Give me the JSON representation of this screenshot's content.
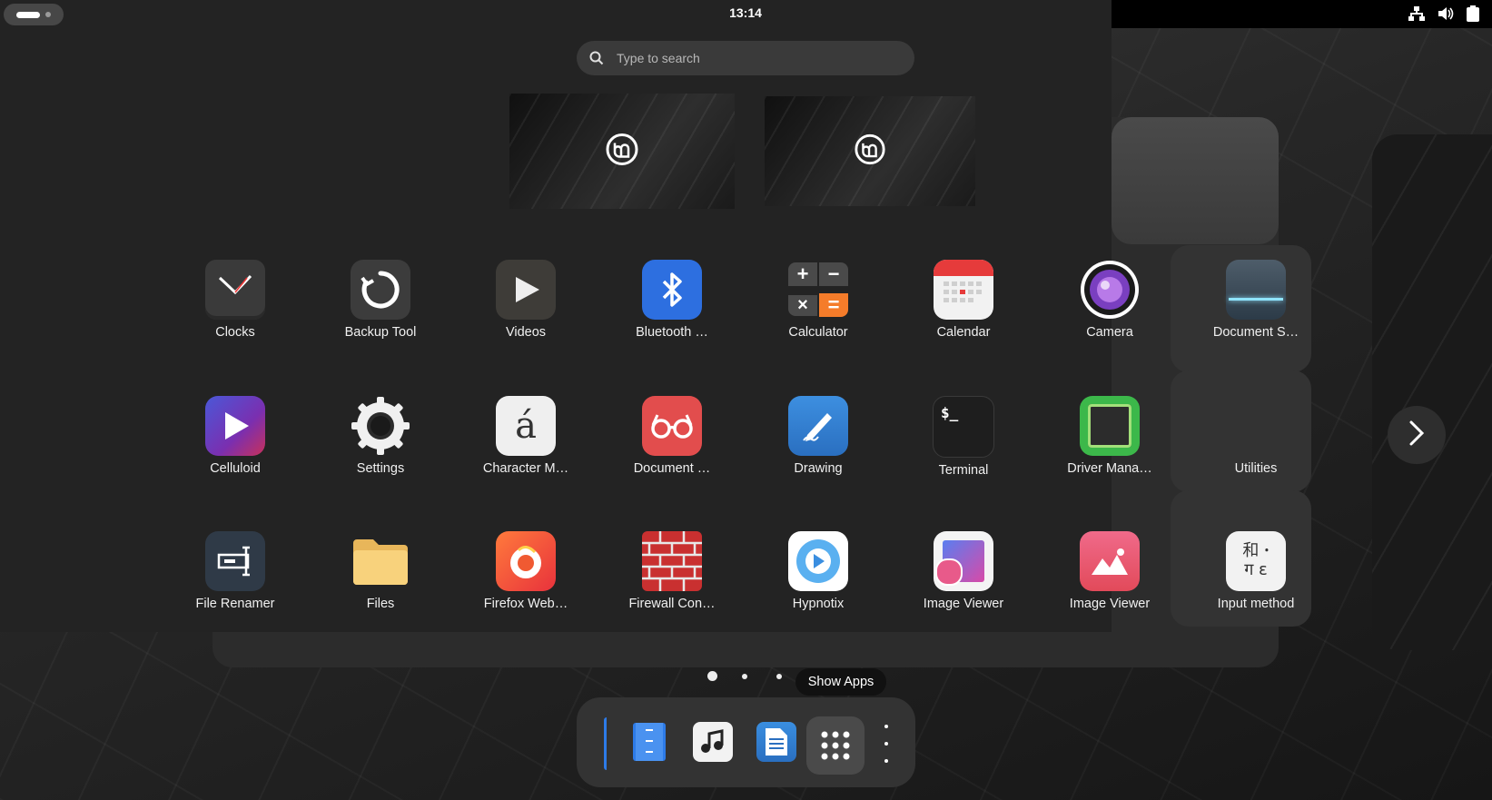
{
  "topbar": {
    "clock": "13:14"
  },
  "search": {
    "placeholder": "Type to search"
  },
  "apps": {
    "row1": [
      "Clocks",
      "Backup Tool",
      "Videos",
      "Bluetooth …",
      "Calculator",
      "Calendar",
      "Camera",
      "Document S…"
    ],
    "row2": [
      "Celluloid",
      "Settings",
      "Character M…",
      "Document …",
      "Drawing",
      "Terminal",
      "Driver Mana…",
      "Utilities"
    ],
    "row3": [
      "File Renamer",
      "Files",
      "Firefox Web…",
      "Firewall Con…",
      "Hypnotix",
      "Image Viewer",
      "Image Viewer",
      "Input method"
    ]
  },
  "tooltip": "Show Apps",
  "pager": {
    "pages": 3,
    "current": 1
  },
  "colors": {
    "overlay": "#232323",
    "accent_blue": "#2d6fe0",
    "search_bg": "#3a3a3a"
  },
  "icons": {
    "tray": [
      "network-icon",
      "volume-icon",
      "battery-icon"
    ],
    "dock": [
      "bookmarks-icon",
      "music-icon",
      "text-editor-icon",
      "show-apps-icon"
    ]
  }
}
